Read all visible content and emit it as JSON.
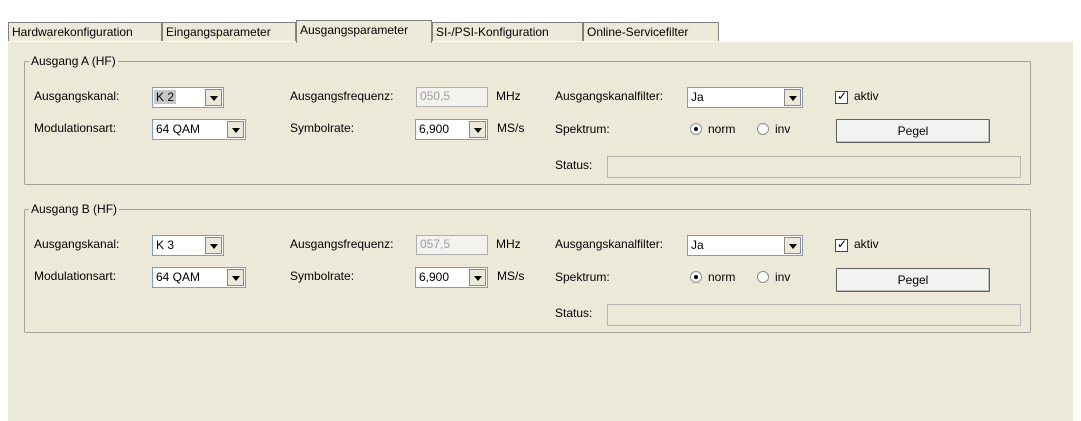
{
  "tabs": [
    {
      "label": "Hardwarekonfiguration"
    },
    {
      "label": "Eingangsparameter"
    },
    {
      "label": "Ausgangsparameter"
    },
    {
      "label": "SI-/PSI-Konfiguration"
    },
    {
      "label": "Online-Servicefilter"
    }
  ],
  "active_tab": "Ausgangsparameter",
  "labels": {
    "ausgangskanal": "Ausgangskanal:",
    "modulationsart": "Modulationsart:",
    "ausgangsfrequenz": "Ausgangsfrequenz:",
    "symbolrate": "Symbolrate:",
    "mhz": "MHz",
    "msps": "MS/s",
    "ausgangskanalfilter": "Ausgangskanalfilter:",
    "spektrum": "Spektrum:",
    "status": "Status:",
    "aktiv": "aktiv",
    "norm": "norm",
    "inv": "inv",
    "pegel": "Pegel"
  },
  "groups": [
    {
      "title": "Ausgang A (HF)",
      "ausgangskanal": "K 2",
      "modulationsart": "64 QAM",
      "ausgangsfrequenz": "050,5",
      "symbolrate": "6,900",
      "ausgangskanalfilter": "Ja",
      "aktiv": true,
      "spektrum": "norm",
      "status": ""
    },
    {
      "title": "Ausgang B (HF)",
      "ausgangskanal": "K 3",
      "modulationsart": "64 QAM",
      "ausgangsfrequenz": "057,5",
      "symbolrate": "6,900",
      "ausgangskanalfilter": "Ja",
      "aktiv": true,
      "spektrum": "norm",
      "status": ""
    }
  ]
}
